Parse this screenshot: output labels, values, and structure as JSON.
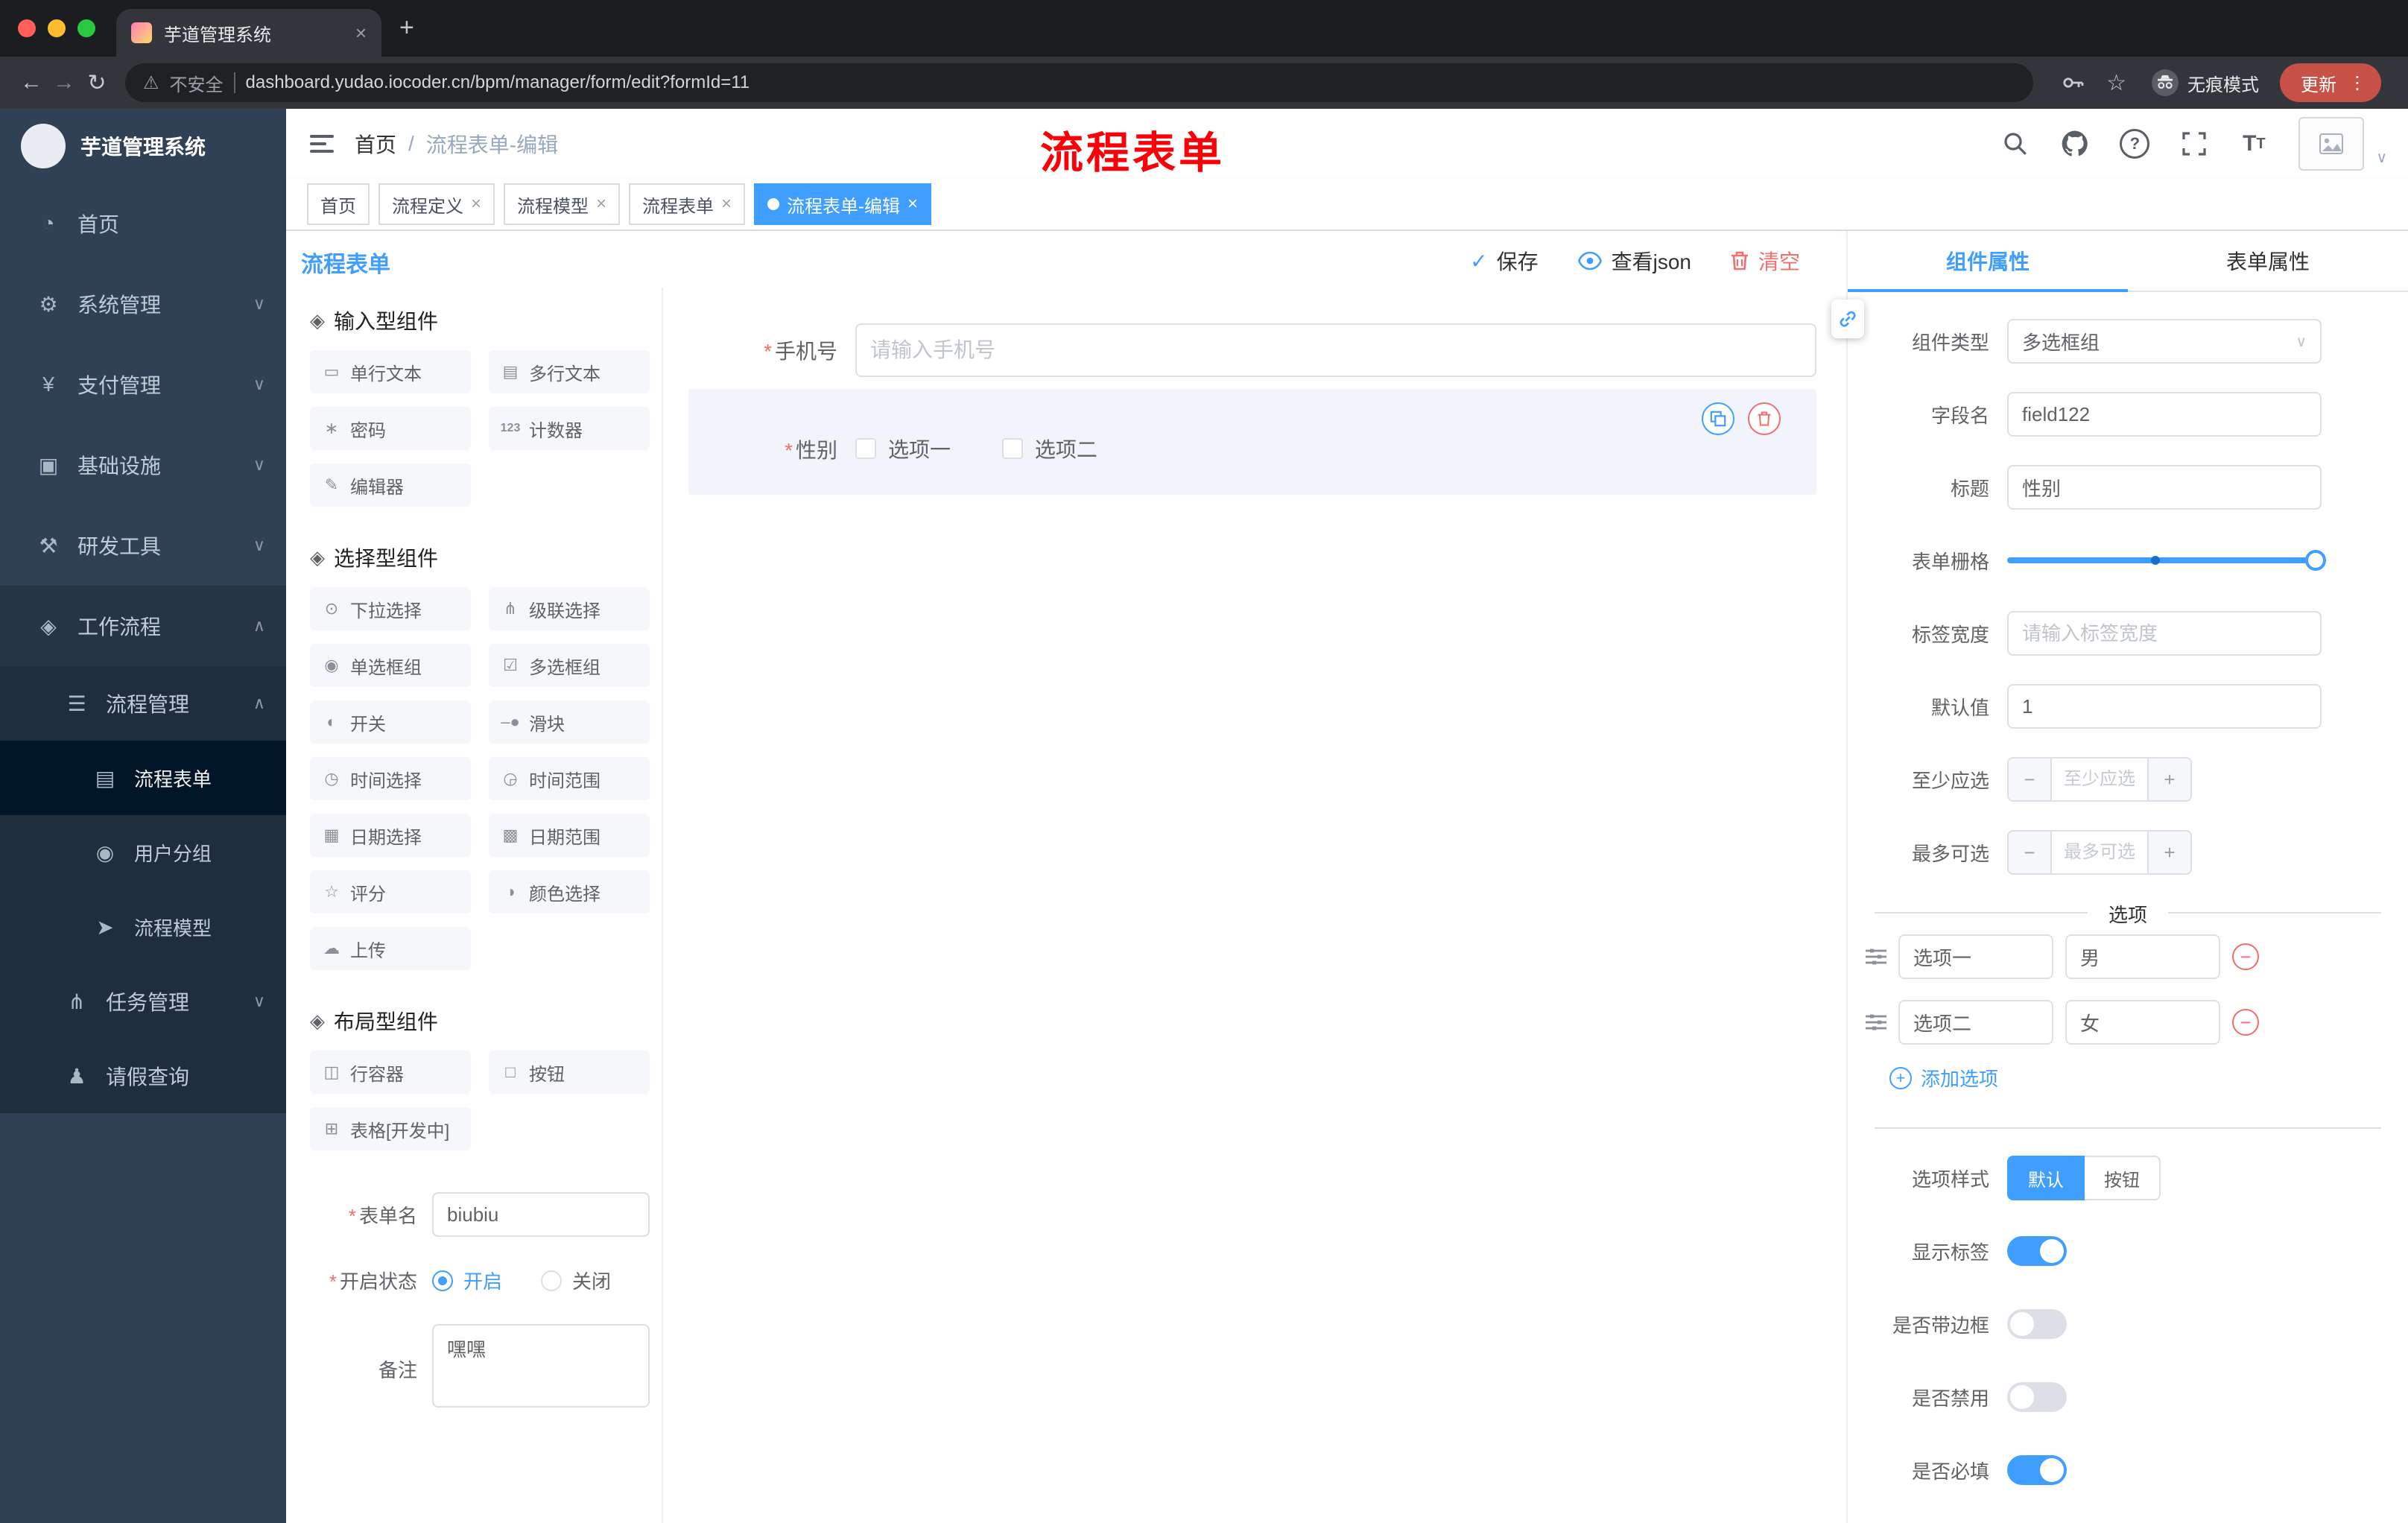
{
  "colors": {
    "accent": "#409eff",
    "danger": "#f56c6c",
    "sidebar_bg": "#304156"
  },
  "browser": {
    "tab_title": "芋道管理系统",
    "security_label": "不安全",
    "url": "dashboard.yudao.iocoder.cn/bpm/manager/form/edit?formId=11",
    "incognito_label": "无痕模式",
    "update_label": "更新"
  },
  "sidebar": {
    "logo_title": "芋道管理系统",
    "items": [
      {
        "icon": "◔",
        "label": "首页"
      },
      {
        "icon": "⚙",
        "label": "系统管理"
      },
      {
        "icon": "¥",
        "label": "支付管理"
      },
      {
        "icon": "▣",
        "label": "基础设施"
      },
      {
        "icon": "⚒",
        "label": "研发工具"
      },
      {
        "icon": "◈",
        "label": "工作流程"
      }
    ],
    "sub": {
      "pm": {
        "icon": "☰",
        "label": "流程管理"
      },
      "pm_children": [
        {
          "icon": "▤",
          "label": "流程表单"
        },
        {
          "icon": "◉",
          "label": "用户分组"
        },
        {
          "icon": "➤",
          "label": "流程模型"
        }
      ],
      "task": {
        "icon": "⋔",
        "label": "任务管理"
      },
      "leave": {
        "icon": "♟",
        "label": "请假查询"
      }
    }
  },
  "header": {
    "breadcrumb": [
      "首页",
      "流程表单-编辑"
    ],
    "annotation": "流程表单"
  },
  "tags": [
    {
      "label": "首页"
    },
    {
      "label": "流程定义"
    },
    {
      "label": "流程模型"
    },
    {
      "label": "流程表单"
    },
    {
      "label": "流程表单-编辑"
    }
  ],
  "designer": {
    "title": "流程表单",
    "actions": {
      "save": "保存",
      "view_json": "查看json",
      "clear": "清空"
    }
  },
  "components": {
    "groups": [
      {
        "title": "输入型组件",
        "items": [
          {
            "icon": "▭",
            "label": "单行文本"
          },
          {
            "icon": "▤",
            "label": "多行文本"
          },
          {
            "icon": "∗",
            "label": "密码"
          },
          {
            "icon": "123",
            "label": "计数器"
          },
          {
            "icon": "✎",
            "label": "编辑器"
          }
        ]
      },
      {
        "title": "选择型组件",
        "items": [
          {
            "icon": "⊙",
            "label": "下拉选择"
          },
          {
            "icon": "⋔",
            "label": "级联选择"
          },
          {
            "icon": "◉",
            "label": "单选框组"
          },
          {
            "icon": "☑",
            "label": "多选框组"
          },
          {
            "icon": "◐",
            "label": "开关"
          },
          {
            "icon": "–●",
            "label": "滑块"
          },
          {
            "icon": "◷",
            "label": "时间选择"
          },
          {
            "icon": "◶",
            "label": "时间范围"
          },
          {
            "icon": "▦",
            "label": "日期选择"
          },
          {
            "icon": "▩",
            "label": "日期范围"
          },
          {
            "icon": "☆",
            "label": "评分"
          },
          {
            "icon": "◑",
            "label": "颜色选择"
          },
          {
            "icon": "☁",
            "label": "上传"
          }
        ]
      },
      {
        "title": "布局型组件",
        "items": [
          {
            "icon": "◫",
            "label": "行容器"
          },
          {
            "icon": "□",
            "label": "按钮"
          },
          {
            "icon": "⊞",
            "label": "表格[开发中]"
          }
        ]
      }
    ]
  },
  "meta_form": {
    "form_name_label": "表单名",
    "form_name_value": "biubiu",
    "status_label": "开启状态",
    "status_on": "开启",
    "status_off": "关闭",
    "remark_label": "备注",
    "remark_value": "嘿嘿"
  },
  "canvas": {
    "phone": {
      "label": "手机号",
      "placeholder": "请输入手机号"
    },
    "gender": {
      "label": "性别",
      "options": [
        "选项一",
        "选项二"
      ]
    }
  },
  "props": {
    "tabs": {
      "component": "组件属性",
      "form": "表单属性"
    },
    "rows": {
      "type_label": "组件类型",
      "type_value": "多选框组",
      "field_label": "字段名",
      "field_value": "field122",
      "title_label": "标题",
      "title_value": "性别",
      "grid_label": "表单栅格",
      "label_width_label": "标签宽度",
      "label_width_placeholder": "请输入标签宽度",
      "default_label": "默认值",
      "default_value": "1",
      "min_label": "至少应选",
      "min_placeholder": "至少应选",
      "max_label": "最多可选",
      "max_placeholder": "最多可选"
    },
    "options_title": "选项",
    "options": [
      {
        "name": "选项一",
        "value": "男"
      },
      {
        "name": "选项二",
        "value": "女"
      }
    ],
    "add_option": "添加选项",
    "style_label": "选项样式",
    "style_default": "默认",
    "style_button": "按钮",
    "switches": [
      {
        "label": "显示标签"
      },
      {
        "label": "是否带边框"
      },
      {
        "label": "是否禁用"
      },
      {
        "label": "是否必填"
      }
    ]
  }
}
